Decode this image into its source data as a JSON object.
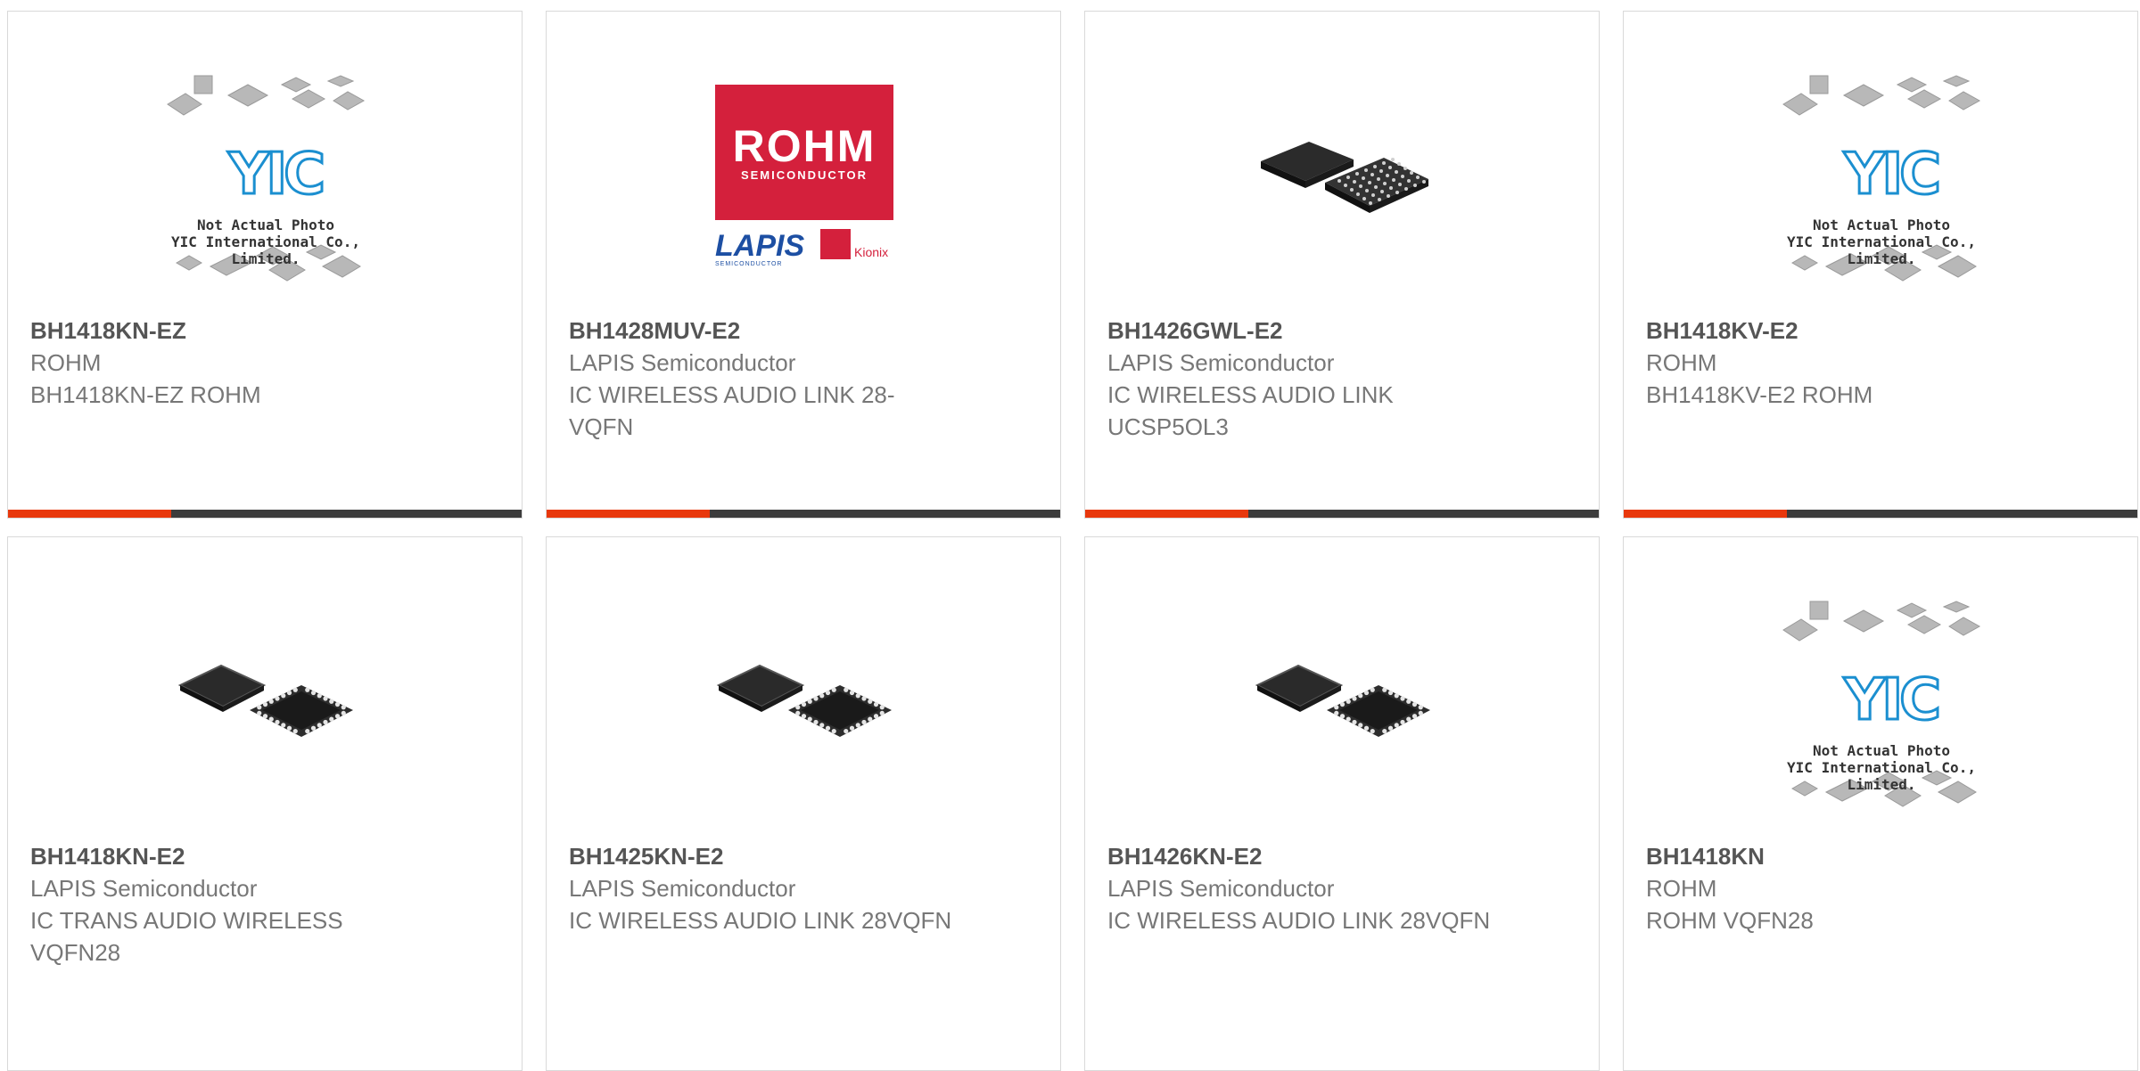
{
  "colors": {
    "accent": "#e8380d",
    "bar": "#3c3c3c",
    "rohm_red": "#d4203c"
  },
  "placeholder": {
    "brand": "YIC",
    "line1": "Not Actual Photo",
    "line2": "YIC International Co., Limited."
  },
  "rohm_logo": {
    "brand": "ROHM",
    "sub": "SEMICONDUCTOR",
    "lapis": "LAPIS",
    "lapis_sub": "SEMICONDUCTOR",
    "kionix": "Kionix"
  },
  "products": [
    {
      "part": "BH1418KN-EZ",
      "manufacturer": "ROHM",
      "description": "BH1418KN-EZ ROHM",
      "image": "placeholder"
    },
    {
      "part": "BH1428MUV-E2",
      "manufacturer": "LAPIS Semiconductor",
      "description": "IC WIRELESS AUDIO LINK 28-VQFN",
      "image": "rohm-logo"
    },
    {
      "part": "BH1426GWL-E2",
      "manufacturer": "LAPIS Semiconductor",
      "description": "IC WIRELESS AUDIO LINK UCSP5OL3",
      "image": "bga-chip"
    },
    {
      "part": "BH1418KV-E2",
      "manufacturer": "ROHM",
      "description": "BH1418KV-E2 ROHM",
      "image": "placeholder"
    },
    {
      "part": "BH1418KN-E2",
      "manufacturer": "LAPIS Semiconductor",
      "description": "IC TRANS AUDIO WIRELESS VQFN28",
      "image": "qfn-chip"
    },
    {
      "part": "BH1425KN-E2",
      "manufacturer": "LAPIS Semiconductor",
      "description": "IC WIRELESS AUDIO LINK 28VQFN",
      "image": "qfn-chip"
    },
    {
      "part": "BH1426KN-E2",
      "manufacturer": "LAPIS Semiconductor",
      "description": "IC WIRELESS AUDIO LINK 28VQFN",
      "image": "qfn-chip"
    },
    {
      "part": "BH1418KN",
      "manufacturer": "ROHM",
      "description": "ROHM VQFN28",
      "image": "placeholder"
    }
  ]
}
